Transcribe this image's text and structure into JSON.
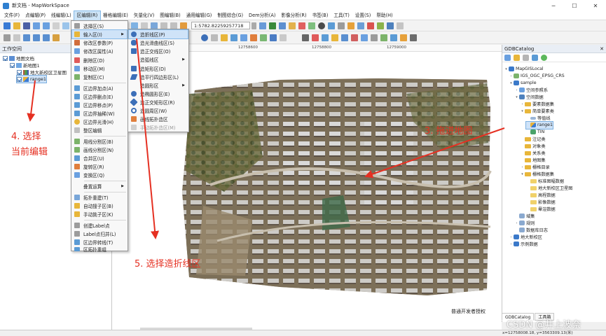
{
  "window": {
    "title": "新文档 - MapWorkSpace"
  },
  "menubar": [
    "文件(F)",
    "点编辑(P)",
    "线编辑(L)",
    "区编辑(R)",
    "栅格编辑(E)",
    "矢量化(V)",
    "图编辑(B)",
    "通用编辑(G)",
    "制图综合(G)",
    "Dem分析(A)",
    "影像分析(R)",
    "书签(B)",
    "工具(T)",
    "设置(S)",
    "帮助(H)"
  ],
  "toolbar": {
    "scale": "1:5782.82259257718"
  },
  "workspace": {
    "title": "工作空间",
    "tree": [
      "地图文档",
      "新地图1",
      "地大新校区卫星图",
      "range1"
    ]
  },
  "region_menu": {
    "items": [
      "选择区(S)",
      "输入区(I)",
      "修改区参数(P)",
      "修改区属性(A)",
      "删除区(D)",
      "移动区(M)",
      "复制区(C)",
      "区边界加点(A)",
      "区边界删点(E)",
      "区边界移点(P)",
      "区边界抽稀(W)",
      "区边界光滑(H)",
      "整区编辑",
      "用线分割区(B)",
      "画线分割区(N)",
      "合并区(U)",
      "旋转区(R)",
      "变换区(Q)",
      "叠置运算",
      "拓扑重建(T)",
      "自动搜子区(B)",
      "手动挑子区(K)",
      "创建Label点",
      "Label点归并(L)",
      "区边界转线(T)",
      "区拓扑重组"
    ]
  },
  "input_submenu": {
    "items": [
      "造折线区(P)",
      "造光滑曲线区(S)",
      "造正交线区(O)",
      "造弧线区",
      "造矩形区(D)",
      "造平行四边形区(L)",
      "造圆形区",
      "造椭圆形区(E)",
      "造正交矩形区(R)",
      "造圆周区(W)",
      "画线拓扑造区",
      "手动拓扑造区(M)"
    ]
  },
  "map": {
    "ruler_labels": [
      "12758600",
      "12758800",
      "12759000"
    ],
    "credit": "普通开发者授权"
  },
  "catalog": {
    "title": "GDBCatalog",
    "items": [
      "MapGISLocal",
      "IGS_OGC_EPSG_CRS",
      "sample",
      "空间参照系",
      "空间数据",
      "要素数据集",
      "简单要素类",
      "等值线",
      "range1",
      "TIN",
      "注记类",
      "对象类",
      "关系类",
      "地图集",
      "栅格目录",
      "栅格数据集",
      "标准图幅数据",
      "地大新校区卫星图",
      "高程数据",
      "影像数据",
      "晕渲数据",
      "域集",
      "规则",
      "数据库日志",
      "地大新校区",
      "示例数据"
    ],
    "tabs": [
      "GDBCatalog",
      "工具箱"
    ]
  },
  "status": {
    "coords": "x=12758008.18, y=3563309.13(米)"
  },
  "annotations": {
    "step3": "3. 拖进地图",
    "step4_line1": "4. 选择",
    "step4_line2": "当前编辑",
    "step5": "5. 选择造折线区"
  },
  "watermark": "CSDN @井上波奈"
}
